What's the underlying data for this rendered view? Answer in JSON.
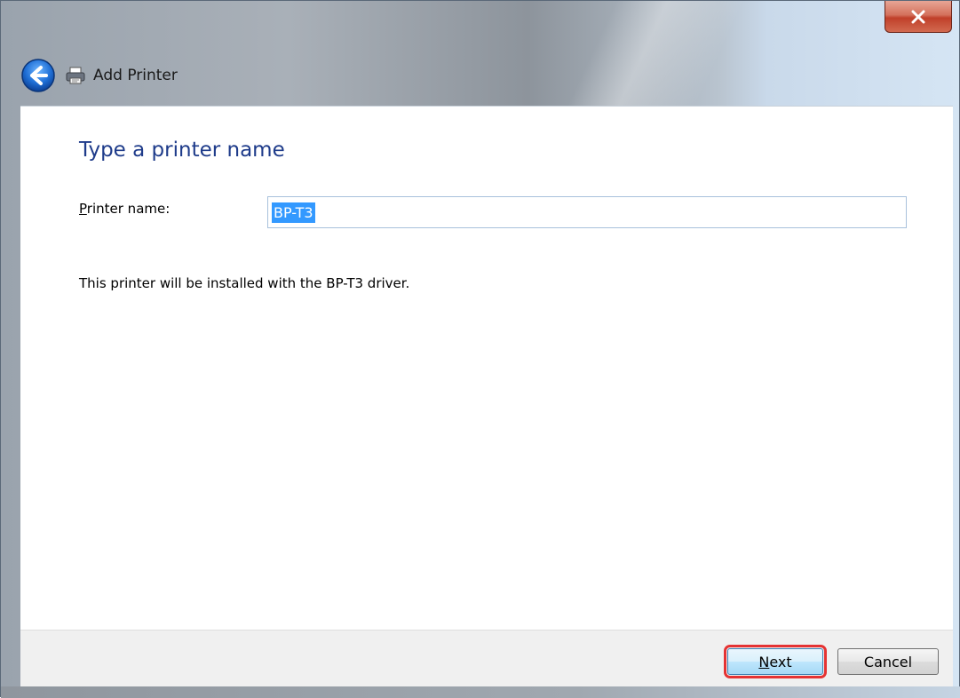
{
  "window": {
    "title": "Add Printer",
    "close_label": "x"
  },
  "page": {
    "heading": "Type a printer name",
    "field_label_accel": "P",
    "field_label_rest": "rinter name:",
    "printer_name_value": "BP-T3",
    "info_text": "This printer will be installed with the BP-T3 driver."
  },
  "footer": {
    "next_accel": "N",
    "next_rest": "ext",
    "cancel_label": "Cancel"
  },
  "colors": {
    "heading": "#1e3b8a",
    "selection": "#3399ff",
    "highlight_box": "#e53333"
  },
  "icons": {
    "back": "back-arrow-icon",
    "printer": "printer-icon",
    "close": "close-icon"
  }
}
